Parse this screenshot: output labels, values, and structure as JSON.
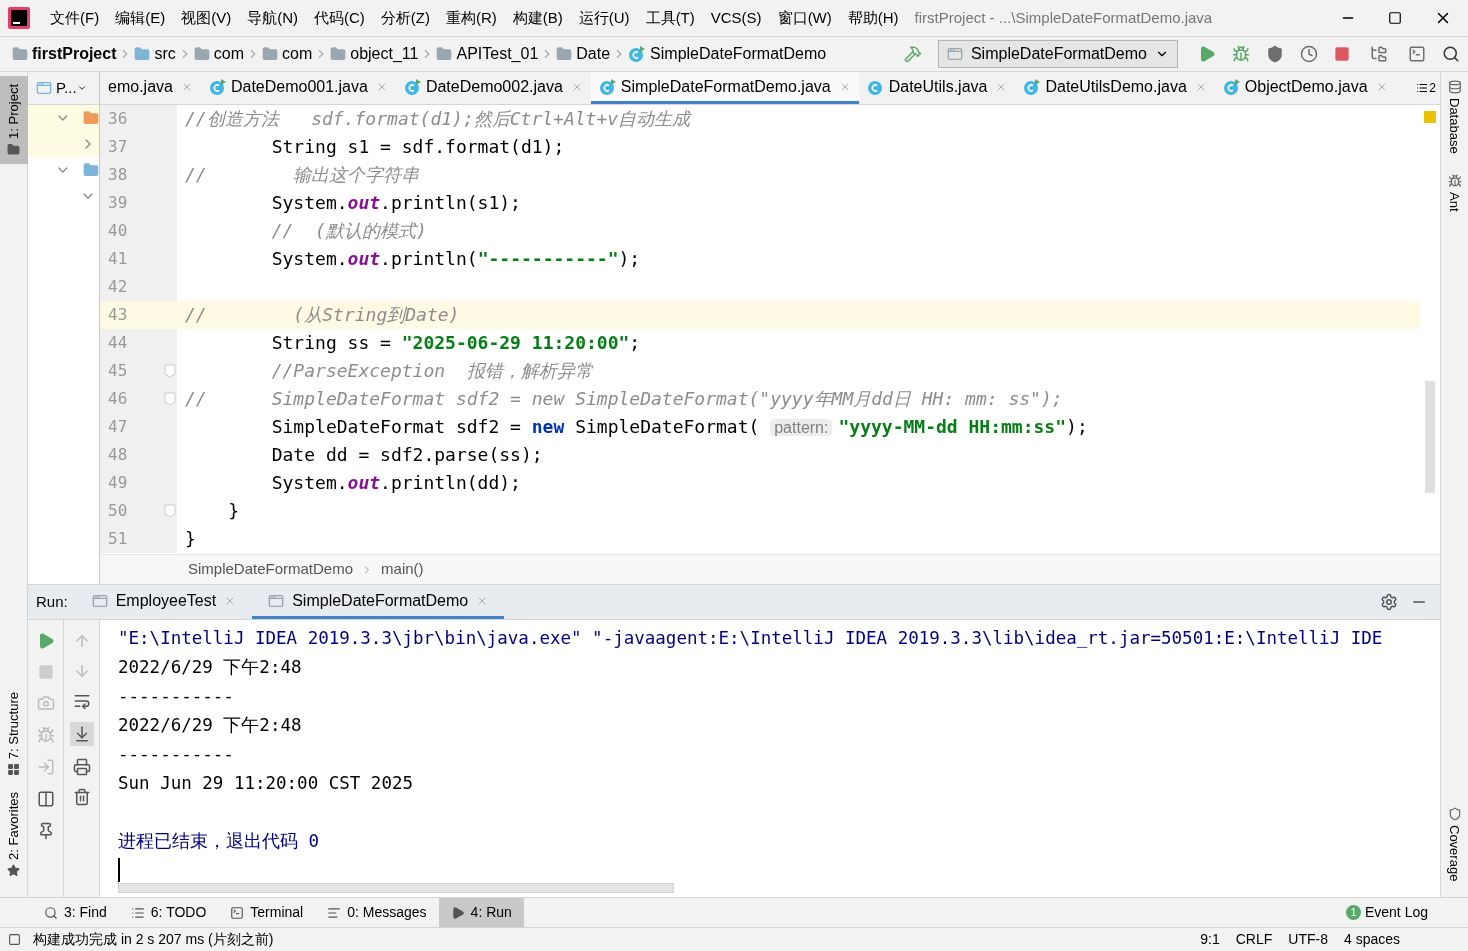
{
  "window": {
    "title": "firstProject - ...\\SimpleDateFormatDemo.java"
  },
  "menu": [
    "文件(F)",
    "编辑(E)",
    "视图(V)",
    "导航(N)",
    "代码(C)",
    "分析(Z)",
    "重构(R)",
    "构建(B)",
    "运行(U)",
    "工具(T)",
    "VCS(S)",
    "窗口(W)",
    "帮助(H)"
  ],
  "nav_bar": {
    "crumbs": [
      {
        "label": "firstProject",
        "kind": "project"
      },
      {
        "label": "src",
        "kind": "source"
      },
      {
        "label": "com",
        "kind": "package"
      },
      {
        "label": "com",
        "kind": "package"
      },
      {
        "label": "object_11",
        "kind": "package"
      },
      {
        "label": "APITest_01",
        "kind": "package"
      },
      {
        "label": "Date",
        "kind": "package"
      },
      {
        "label": "SimpleDateFormatDemo",
        "kind": "class"
      }
    ],
    "run_config": "SimpleDateFormatDemo"
  },
  "left_stripe": [
    {
      "label": "1: Project",
      "selected": true,
      "kind": "project"
    },
    {
      "label": "7: Structure",
      "selected": false,
      "kind": "structure"
    },
    {
      "label": "2: Favorites",
      "selected": false,
      "kind": "favorites"
    }
  ],
  "right_stripe": [
    {
      "label": "Database",
      "kind": "database"
    },
    {
      "label": "Ant",
      "kind": "ant"
    },
    {
      "label": "Coverage",
      "kind": "coverage"
    }
  ],
  "project_panel": {
    "title": "P...",
    "tree": [
      {
        "kind": "module",
        "expanded": true,
        "selected": true,
        "children": [
          {
            "expanded": false,
            "selected": true
          }
        ]
      },
      {
        "kind": "source",
        "expanded": true,
        "selected": false,
        "children": [
          {
            "expanded": true,
            "selected": false
          }
        ]
      }
    ]
  },
  "editor_tabs": [
    {
      "label": "emo.java",
      "kind": "cut",
      "selected": false
    },
    {
      "label": "DateDemo001.java",
      "kind": "runnable",
      "selected": false
    },
    {
      "label": "DateDemo002.java",
      "kind": "runnable",
      "selected": false
    },
    {
      "label": "SimpleDateFormatDemo.java",
      "kind": "runnable",
      "selected": true
    },
    {
      "label": "DateUtils.java",
      "kind": "class",
      "selected": false
    },
    {
      "label": "DateUtilsDemo.java",
      "kind": "runnable",
      "selected": false
    },
    {
      "label": "ObjectDemo.java",
      "kind": "runnable",
      "selected": false
    }
  ],
  "tab_overflow": "2",
  "code": [
    {
      "number": "36",
      "current": false,
      "fold": false,
      "tokens": [
        {
          "kind": "comment",
          "text": "//创造方法   sdf.format(d1);然后Ctrl+Alt+v自动生成"
        }
      ]
    },
    {
      "number": "37",
      "current": false,
      "fold": false,
      "tokens": [
        {
          "kind": "text",
          "text": "        String s1 = sdf.format(d1);"
        }
      ]
    },
    {
      "number": "38",
      "current": false,
      "fold": false,
      "tokens": [
        {
          "kind": "comment",
          "text": "//        输出这个字符串"
        }
      ]
    },
    {
      "number": "39",
      "current": false,
      "fold": false,
      "tokens": [
        {
          "kind": "text",
          "text": "        System."
        },
        {
          "kind": "field",
          "text": "out"
        },
        {
          "kind": "text",
          "text": ".println(s1);"
        }
      ]
    },
    {
      "number": "40",
      "current": false,
      "fold": false,
      "tokens": [
        {
          "kind": "comment",
          "text": "        //  (默认的模式)"
        }
      ]
    },
    {
      "number": "41",
      "current": false,
      "fold": false,
      "tokens": [
        {
          "kind": "text",
          "text": "        System."
        },
        {
          "kind": "field",
          "text": "out"
        },
        {
          "kind": "text",
          "text": ".println("
        },
        {
          "kind": "string",
          "text": "\"-----------\""
        },
        {
          "kind": "text",
          "text": ");"
        }
      ]
    },
    {
      "number": "42",
      "current": false,
      "fold": false
    },
    {
      "number": "43",
      "current": true,
      "fold": false,
      "tokens": [
        {
          "kind": "comment",
          "text": "//        (从String到Date)"
        }
      ]
    },
    {
      "number": "44",
      "current": false,
      "fold": false,
      "tokens": [
        {
          "kind": "text",
          "text": "        String ss = "
        },
        {
          "kind": "string",
          "text": "\"2025-06-29 11:20:00\""
        },
        {
          "kind": "text",
          "text": ";"
        }
      ]
    },
    {
      "number": "45",
      "current": false,
      "fold": true,
      "tokens": [
        {
          "kind": "comment",
          "text": "        //ParseException  报错，解析异常"
        }
      ]
    },
    {
      "number": "46",
      "current": false,
      "fold": true,
      "tokens": [
        {
          "kind": "comment",
          "text": "//      SimpleDateFormat sdf2 = new SimpleDateFormat(\"yyyy年MM月dd日 HH: mm: ss\");"
        }
      ]
    },
    {
      "number": "47",
      "current": false,
      "fold": false,
      "tokens": [
        {
          "kind": "text",
          "text": "        SimpleDateFormat sdf2 = "
        },
        {
          "kind": "keyword",
          "text": "new"
        },
        {
          "kind": "text",
          "text": " SimpleDateFormat( "
        },
        {
          "kind": "hint",
          "text": "pattern:"
        },
        {
          "kind": "string",
          "text": "\"yyyy-MM-dd HH:mm:ss\""
        },
        {
          "kind": "text",
          "text": ");"
        }
      ]
    },
    {
      "number": "48",
      "current": false,
      "fold": false,
      "tokens": [
        {
          "kind": "text",
          "text": "        Date dd = sdf2.parse(ss);"
        }
      ]
    },
    {
      "number": "49",
      "current": false,
      "fold": false,
      "tokens": [
        {
          "kind": "text",
          "text": "        System."
        },
        {
          "kind": "field",
          "text": "out"
        },
        {
          "kind": "text",
          "text": ".println(dd);"
        }
      ]
    },
    {
      "number": "50",
      "current": false,
      "fold": true,
      "tokens": [
        {
          "kind": "text",
          "text": "    }"
        }
      ]
    },
    {
      "number": "51",
      "current": false,
      "fold": false,
      "tokens": [
        {
          "kind": "text",
          "text": "}"
        }
      ]
    }
  ],
  "editor_breadcrumb": [
    "SimpleDateFormatDemo",
    "main()"
  ],
  "run": {
    "label": "Run:",
    "tabs": [
      {
        "label": "EmployeeTest",
        "selected": false
      },
      {
        "label": "SimpleDateFormatDemo",
        "selected": true
      }
    ],
    "lines": [
      {
        "kind": "command",
        "text": "\"E:\\IntelliJ IDEA 2019.3.3\\jbr\\bin\\java.exe\" \"-javaagent:E:\\IntelliJ IDEA 2019.3.3\\lib\\idea_rt.jar=50501:E:\\IntelliJ IDE"
      },
      {
        "kind": "output",
        "text": "2022/6/29 下午2:48"
      },
      {
        "kind": "output",
        "text": "-----------"
      },
      {
        "kind": "output",
        "text": "2022/6/29 下午2:48"
      },
      {
        "kind": "output",
        "text": "-----------"
      },
      {
        "kind": "output",
        "text": "Sun Jun 29 11:20:00 CST 2025"
      },
      {
        "kind": "exit",
        "text": "进程已结束，退出代码 0"
      }
    ]
  },
  "tool_tabs": [
    {
      "label": "3: Find",
      "kind": "find",
      "selected": false
    },
    {
      "label": "6: TODO",
      "kind": "todo",
      "selected": false
    },
    {
      "label": "Terminal",
      "kind": "terminal",
      "selected": false
    },
    {
      "label": "0: Messages",
      "kind": "messages",
      "selected": false
    },
    {
      "label": "4: Run",
      "kind": "run",
      "selected": true
    }
  ],
  "status_bar": {
    "message": "构建成功完成 in 2 s 207 ms (片刻之前)",
    "event_log": {
      "label": "Event Log",
      "count": "1"
    },
    "items": [
      "9:1",
      "CRLF",
      "UTF-8",
      "4 spaces"
    ]
  }
}
